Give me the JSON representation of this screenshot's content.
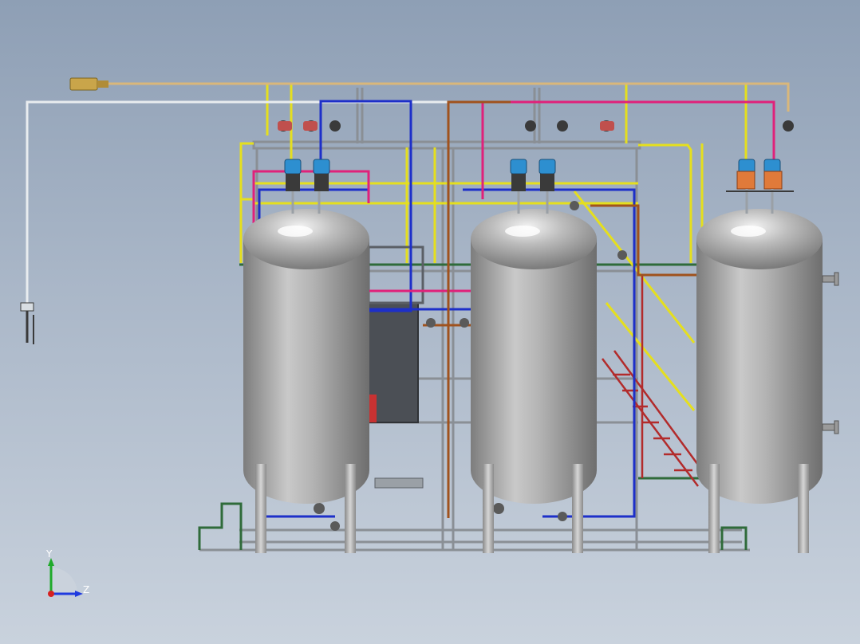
{
  "scene": {
    "background_top": "#8e9fb5",
    "background_bottom": "#c9d2dd",
    "colors": {
      "tank_body": "#a9a9a9",
      "tank_highlight": "#e6e6e6",
      "pipe_yellow": "#e5df1e",
      "pipe_blue": "#1d2fc9",
      "pipe_magenta": "#e0217a",
      "pipe_brown": "#a0521d",
      "pipe_tan": "#d9b77a",
      "pipe_white": "#e8ecef",
      "frame_gray": "#8a8f95",
      "frame_green": "#2f6b3a",
      "stair_red": "#b22b2b",
      "valve_blue": "#2d8fd0",
      "valve_orange": "#e07a3a",
      "valve_dark": "#3a3a3a",
      "filter_dark": "#4b4f55"
    },
    "tanks": [
      {
        "name": "tank-left"
      },
      {
        "name": "tank-middle"
      },
      {
        "name": "tank-right"
      }
    ]
  },
  "triad": {
    "y_label": "Y",
    "z_label": "Z",
    "x_color": "#d62020",
    "y_color": "#1faa2a",
    "z_color": "#1f3adf"
  }
}
